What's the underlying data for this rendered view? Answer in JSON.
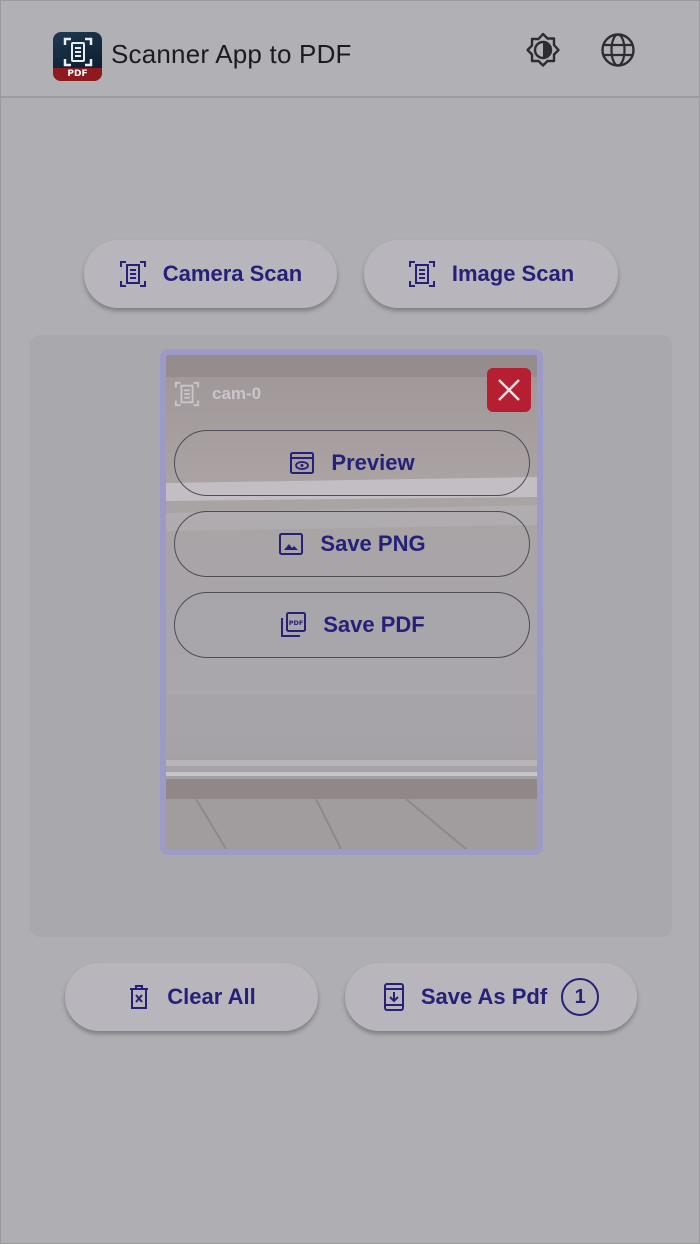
{
  "app": {
    "title": "Scanner App to PDF",
    "logo_badge": "PDF"
  },
  "header_icons": [
    "brightness-icon",
    "globe-icon"
  ],
  "scan_buttons": {
    "camera_label": "Camera Scan",
    "image_label": "Image Scan"
  },
  "scan_card": {
    "name": "cam-0",
    "preview_label": "Preview",
    "save_png_label": "Save PNG",
    "save_pdf_label": "Save PDF"
  },
  "bottom_buttons": {
    "clear_label": "Clear All",
    "save_as_pdf_label": "Save As Pdf",
    "save_count": "1"
  },
  "colors": {
    "accent_text": "#262178",
    "close_button": "#b51f31",
    "card_border": "#9c9bc7"
  }
}
